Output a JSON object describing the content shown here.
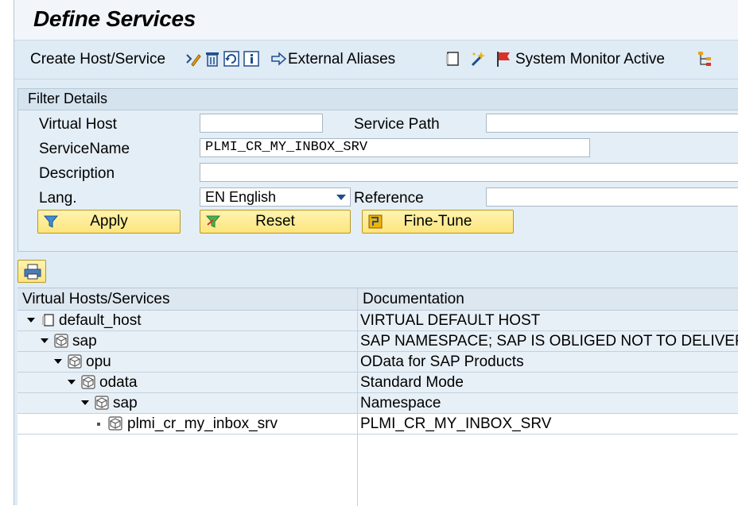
{
  "window": {
    "title": "Define Services"
  },
  "toolbar": {
    "create_label": "Create Host/Service",
    "aliases_label": "External Aliases",
    "monitor_label": "System Monitor Active",
    "icons": [
      "edit-icon",
      "delete-icon",
      "refresh-icon",
      "info-icon",
      "arrow-right-icon",
      "doc-icon",
      "magic-wand-icon",
      "flag-icon",
      "hierarchy-icon"
    ]
  },
  "filter": {
    "header": "Filter Details",
    "virtual_host_label": "Virtual Host",
    "virtual_host_value": "",
    "service_path_label": "Service Path",
    "service_path_value": "",
    "service_name_label": "ServiceName",
    "service_name_value": "PLMI_CR_MY_INBOX_SRV",
    "description_label": "Description",
    "description_value": "",
    "lang_label": "Lang.",
    "lang_value": "EN English",
    "reference_label": "Reference",
    "reference_value": "",
    "apply_label": "Apply",
    "reset_label": "Reset",
    "finetune_label": "Fine-Tune"
  },
  "grid": {
    "columns": [
      "Virtual Hosts/Services",
      "Documentation"
    ],
    "rows": [
      {
        "name": "default_host",
        "doc": "VIRTUAL DEFAULT HOST"
      },
      {
        "name": "sap",
        "doc": "SAP NAMESPACE; SAP IS OBLIGED NOT TO DELIVER A"
      },
      {
        "name": "opu",
        "doc": "OData for SAP Products"
      },
      {
        "name": "odata",
        "doc": "Standard Mode"
      },
      {
        "name": "sap",
        "doc": "Namespace"
      },
      {
        "name": "plmi_cr_my_inbox_srv",
        "doc": "PLMI_CR_MY_INBOX_SRV"
      }
    ]
  },
  "colors": {
    "accent": "#1f4e8c",
    "button": "#fde57e",
    "background": "#dfebf5"
  }
}
